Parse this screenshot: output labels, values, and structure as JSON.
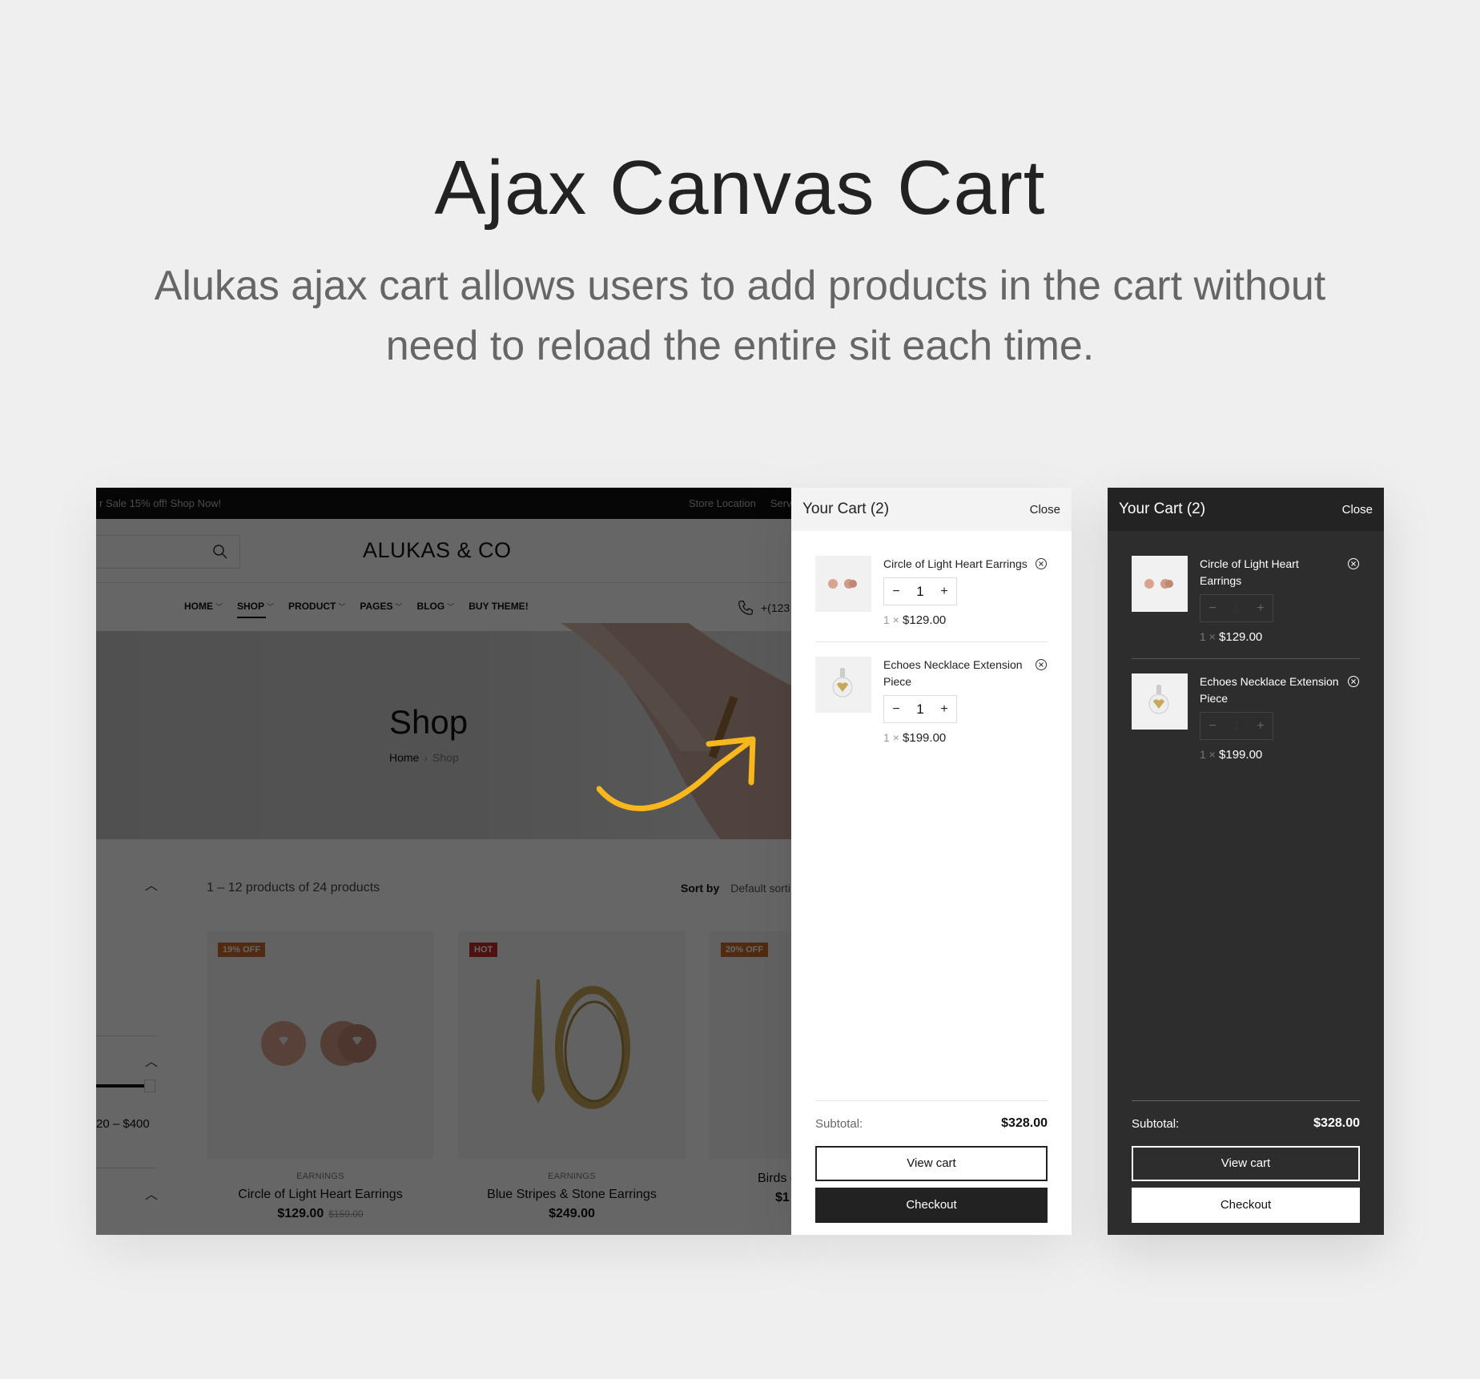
{
  "hero": {
    "title": "Ajax Canvas Cart",
    "subtitle_line1": "Alukas ajax cart allows users to add products in the cart without",
    "subtitle_line2": "need to reload the entire sit each time."
  },
  "shop": {
    "topbar": {
      "promo": "r Sale 15% off! Shop Now!",
      "links": [
        "Store Location",
        "Serv"
      ]
    },
    "search": {
      "icon": "search-icon"
    },
    "logo": "ALUKAS & CO",
    "nav": [
      {
        "label": "HOME",
        "has_dropdown": true,
        "active": false
      },
      {
        "label": "SHOP",
        "has_dropdown": true,
        "active": true
      },
      {
        "label": "PRODUCT",
        "has_dropdown": true,
        "active": false
      },
      {
        "label": "PAGES",
        "has_dropdown": true,
        "active": false
      },
      {
        "label": "BLOG",
        "has_dropdown": true,
        "active": false
      },
      {
        "label": "BUY THEME!",
        "has_dropdown": false,
        "active": false
      }
    ],
    "phone": {
      "icon": "phone-icon",
      "text": "+(123"
    },
    "banner": {
      "title": "Shop",
      "breadcrumb": [
        "Home",
        "Shop"
      ]
    },
    "listing": {
      "count_text": "1 – 12 products of 24 products",
      "sort_label": "Sort by",
      "sort_value": "Default sorti",
      "price_range": "20 – $400"
    },
    "products": [
      {
        "badge": "19% OFF",
        "badge_color": "#c96a2b",
        "category": "EARNINGS",
        "name": "Circle of Light Heart Earrings",
        "price": "$129.00",
        "old_price": "$159.00"
      },
      {
        "badge": "HOT",
        "badge_color": "#c62828",
        "category": "EARNINGS",
        "name": "Blue Stripes & Stone Earrings",
        "price": "$249.00",
        "old_price": ""
      },
      {
        "badge": "20% OFF",
        "badge_color": "#c96a2b",
        "category": "",
        "name": "Birds o",
        "price": "$1",
        "old_price": ""
      }
    ]
  },
  "cart": {
    "title": "Your Cart (2)",
    "close_label": "Close",
    "items": [
      {
        "name": "Circle of Light Heart Earrings",
        "qty": "1",
        "mult": "1 ×",
        "price": "$129.00"
      },
      {
        "name": "Echoes Necklace Extension Piece",
        "qty": "1",
        "mult": "1 ×",
        "price": "$199.00"
      }
    ],
    "subtotal_label": "Subtotal:",
    "subtotal_value": "$328.00",
    "view_cart_label": "View cart",
    "checkout_label": "Checkout",
    "qty_minus": "−",
    "qty_plus": "+"
  },
  "colors": {
    "accent_arrow": "#f7b71d",
    "dark_panel": "#2d2d2d",
    "overlay": "rgba(0,0,0,0.6)"
  }
}
